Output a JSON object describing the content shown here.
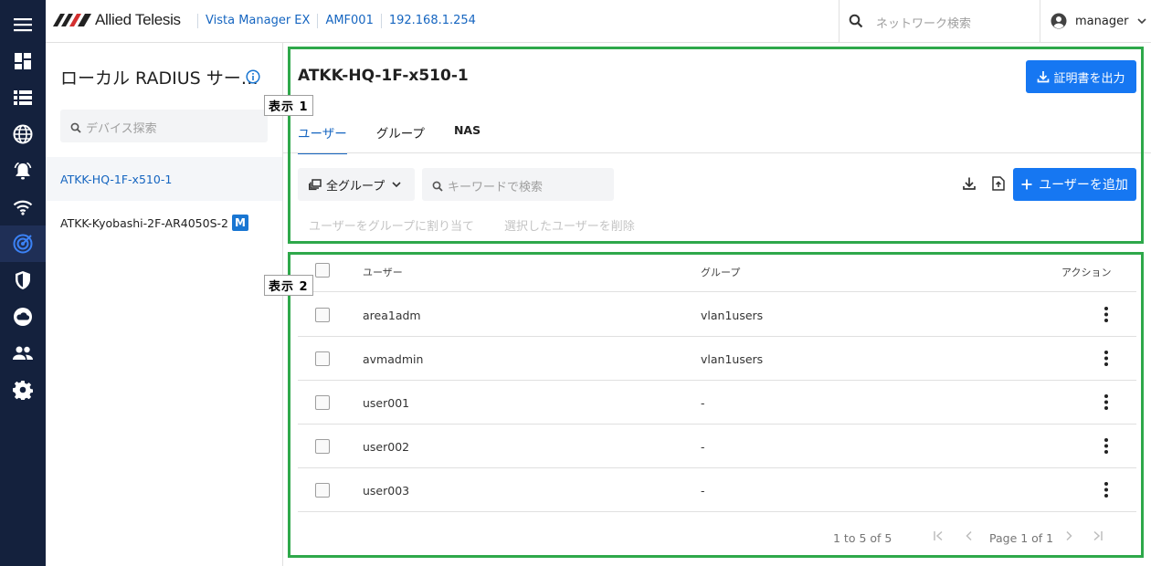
{
  "brand": {
    "logo_text": "Allied Telesis"
  },
  "header": {
    "breadcrumbs": [
      "Vista Manager EX",
      "AMF001",
      "192.168.1.254"
    ],
    "search_placeholder": "ネットワーク検索",
    "user_name": "manager"
  },
  "rail": {
    "items": [
      "menu-icon",
      "dashboard-icon",
      "list-icon",
      "globe-icon",
      "alarm-icon",
      "wifi-icon",
      "radius-icon",
      "shield-icon",
      "cloud-icon",
      "users-icon",
      "settings-icon"
    ],
    "active_index": 6
  },
  "sidebar": {
    "title": "ローカル RADIUS サー…",
    "search_placeholder": "デバイス探索",
    "devices": [
      {
        "name": "ATKK-HQ-1F-x510-1",
        "badge": "",
        "active": true
      },
      {
        "name": "ATKK-Kyobashi-2F-AR4050S-2",
        "badge": "M",
        "active": false
      }
    ]
  },
  "main": {
    "device_title": "ATKK-HQ-1F-x510-1",
    "export_cert_label": "証明書を出力",
    "tabs": [
      "ユーザー",
      "グループ",
      "NAS"
    ],
    "active_tab": 0,
    "group_filter_label": "全グループ",
    "keyword_placeholder": "キーワードで検索",
    "add_user_label": "ユーザーを追加",
    "bulk_actions": [
      "ユーザーをグループに割り当て",
      "選択したユーザーを削除"
    ]
  },
  "annotations": {
    "label1": "表示 1",
    "label2": "表示 2"
  },
  "table": {
    "columns": [
      "ユーザー",
      "グループ",
      "アクション"
    ],
    "rows": [
      {
        "user": "area1adm",
        "group": "vlan1users"
      },
      {
        "user": "avmadmin",
        "group": "vlan1users"
      },
      {
        "user": "user001",
        "group": "-"
      },
      {
        "user": "user002",
        "group": "-"
      },
      {
        "user": "user003",
        "group": "-"
      }
    ]
  },
  "pagination": {
    "range": "1 to 5 of 5",
    "page": "Page 1 of 1"
  },
  "colors": {
    "rail_bg": "#14213d",
    "primary": "#1677f2",
    "link": "#1565c0",
    "outline": "#2ea84a",
    "badge": "#1976d2"
  }
}
